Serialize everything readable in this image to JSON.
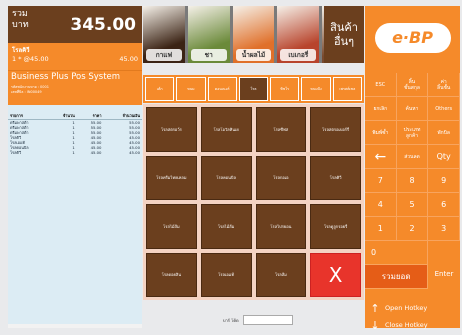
{
  "total": {
    "label": "รวม\nบาท",
    "value": "345.00"
  },
  "last_item": {
    "name": "โรลคิวี",
    "qty_price": "1 * @45.00",
    "amount": "45.00"
  },
  "system": {
    "title": "Business Plus Pos System",
    "line1": "รหัสพนักงานขาย : 0001",
    "line2": "เลขที่บิล : IN00049"
  },
  "sales": {
    "headers": [
      "รายการ",
      "จำนวน",
      "ราคา",
      "จำนวนเงิน"
    ],
    "rows": [
      [
        "ดรีมพาสต้า",
        "1",
        "55.00",
        "55.00"
      ],
      [
        "ดรีมพาสต้า",
        "1",
        "55.00",
        "55.00"
      ],
      [
        "ดรีมพาสต้า",
        "1",
        "55.00",
        "55.00"
      ],
      [
        "โรลคิวี",
        "1",
        "45.00",
        "45.00"
      ],
      [
        "โรลเอแท้",
        "1",
        "45.00",
        "45.00"
      ],
      [
        "โรลคอนบิล",
        "1",
        "45.00",
        "45.00"
      ],
      [
        "โรลคิวี",
        "1",
        "45.00",
        "45.00"
      ]
    ]
  },
  "categories": [
    {
      "label": "กาแฟ",
      "color": "#3b2314"
    },
    {
      "label": "ชา",
      "color": "#6b8a3a"
    },
    {
      "label": "น้ำผลไม้",
      "color": "#e0702a"
    },
    {
      "label": "เบเกอรี่",
      "color": "#b8442c"
    },
    {
      "label": "เบเกอรี่",
      "color": "#7a4a2e"
    }
  ],
  "more_label": "สินค้า\nอื่นๆ",
  "subcats": [
    "เค้ก",
    "ขนม",
    "คอนเนอร์",
    "โรล",
    "ทิชโร",
    "ขนมปัง",
    "เพรสต์เซล"
  ],
  "active_subcat_index": 3,
  "products": [
    "โรลสตรอว์ร",
    "โรลโอวัลทินเย",
    "โรลซีฟส",
    "โรลสตรอเบอร์รี่",
    "โรลครีมไทยเหลม",
    "โรลคอนบิล",
    "โรลกอเอ",
    "โรลคิวี",
    "โรลไม้ส้ม",
    "โรลไม้ส้ม",
    "โรลไปรยอน",
    "โรลดูลูกรอยรี่",
    "โรลดอยลิน",
    "โรลเอแท้",
    "โรลส้ม",
    "X"
  ],
  "barcode": {
    "label": "บาร์ โค้ด",
    "value": ""
  },
  "logo_text": "e·BP",
  "keys": [
    {
      "label": "ESC",
      "cls": "small"
    },
    {
      "label": "ลิ้น\nชั้นสกุล",
      "cls": "small"
    },
    {
      "label": "ค่า\nลิ้นชั้น",
      "cls": "small"
    },
    {
      "label": "ยกเลิก",
      "cls": "small"
    },
    {
      "label": "ค้นหา",
      "cls": "small"
    },
    {
      "label": "Others",
      "cls": "small"
    },
    {
      "label": "พิมพ์ซ้ำ",
      "cls": "small"
    },
    {
      "label": "ประเภท\nลูกค้า",
      "cls": "small"
    },
    {
      "label": "พักบิล",
      "cls": "small"
    },
    {
      "label": "←",
      "cls": "back"
    },
    {
      "label": "ส่วนลด",
      "cls": "small"
    },
    {
      "label": "Qty",
      "cls": ""
    },
    {
      "label": "7",
      "cls": ""
    },
    {
      "label": "8",
      "cls": ""
    },
    {
      "label": "9",
      "cls": ""
    },
    {
      "label": "4",
      "cls": ""
    },
    {
      "label": "5",
      "cls": ""
    },
    {
      "label": "6",
      "cls": ""
    },
    {
      "label": "1",
      "cls": ""
    },
    {
      "label": "2",
      "cls": ""
    },
    {
      "label": "3",
      "cls": ""
    },
    {
      "label": "0",
      "cls": "zero"
    }
  ],
  "pay_label": "รวมยอด",
  "enter_label": "Enter",
  "open_hotkey": "Open Hotkey",
  "close_hotkey": "Close Hotkey",
  "colors": {
    "brown": "#6b3f1e",
    "orange": "#f58a2a",
    "red": "#e8342b"
  }
}
